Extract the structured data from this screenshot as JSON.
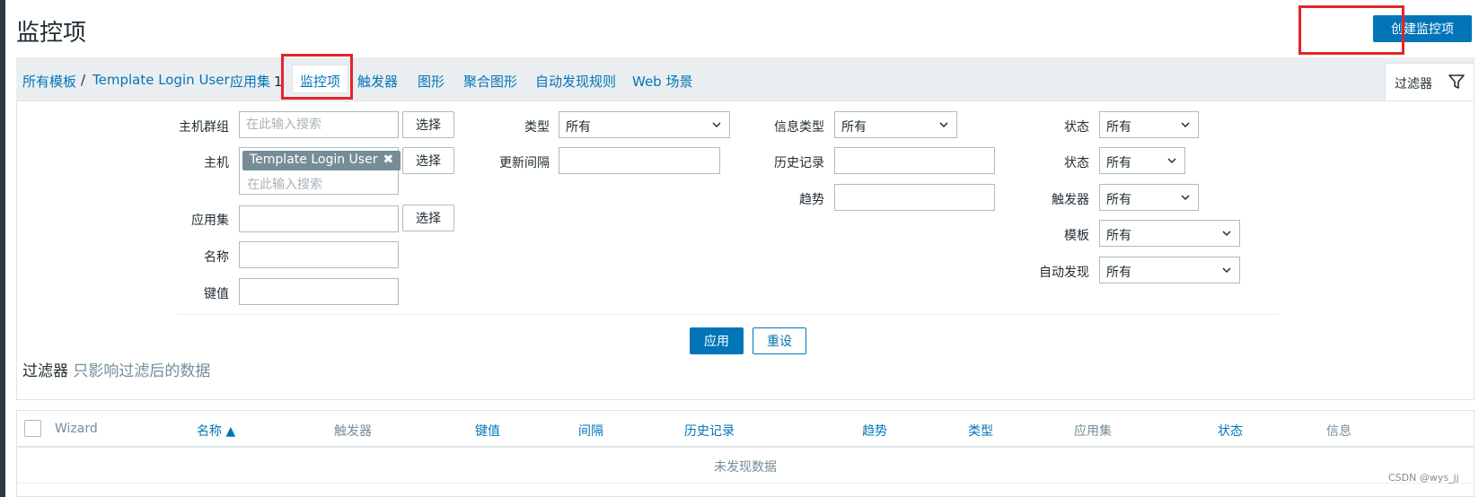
{
  "page": {
    "title": "监控项",
    "create_button": "创建监控项"
  },
  "breadcrumbs": {
    "all_templates": "所有模板",
    "separator": "/",
    "template": "Template Login User",
    "applications": "应用集",
    "applications_count": "1",
    "items": "监控项",
    "triggers": "触发器",
    "graphs": "图形",
    "screens": "聚合图形",
    "discovery": "自动发现规则",
    "web": "Web 场景"
  },
  "filter_tab": {
    "label": "过滤器",
    "icon": "filter-icon"
  },
  "filter": {
    "host_group": {
      "label": "主机群组",
      "placeholder": "在此输入搜索",
      "select": "选择"
    },
    "host": {
      "label": "主机",
      "chip": "Template Login User",
      "placeholder": "在此输入搜索",
      "select": "选择"
    },
    "application": {
      "label": "应用集",
      "value": "",
      "select": "选择"
    },
    "name": {
      "label": "名称",
      "value": ""
    },
    "key": {
      "label": "键值",
      "value": ""
    },
    "type": {
      "label": "类型",
      "value": "所有"
    },
    "update_interval": {
      "label": "更新间隔",
      "value": ""
    },
    "info_type": {
      "label": "信息类型",
      "value": "所有"
    },
    "history": {
      "label": "历史记录",
      "value": ""
    },
    "trends": {
      "label": "趋势",
      "value": ""
    },
    "state": {
      "label": "状态",
      "value": "所有"
    },
    "status": {
      "label": "状态",
      "value": "所有"
    },
    "triggers": {
      "label": "触发器",
      "value": "所有"
    },
    "template": {
      "label": "模板",
      "value": "所有"
    },
    "discovery": {
      "label": "自动发现",
      "value": "所有"
    },
    "apply": "应用",
    "reset": "重设",
    "note_title": "过滤器",
    "note_text": "只影响过滤后的数据"
  },
  "table": {
    "columns": [
      "Wizard",
      "名称 ▲",
      "触发器",
      "键值",
      "间隔",
      "历史记录",
      "趋势",
      "类型",
      "应用集",
      "状态",
      "信息"
    ],
    "empty": "未发现数据"
  },
  "watermark": "CSDN @wys_jj",
  "colors": {
    "accent": "#0275b8",
    "highlight": "#e3242b"
  }
}
